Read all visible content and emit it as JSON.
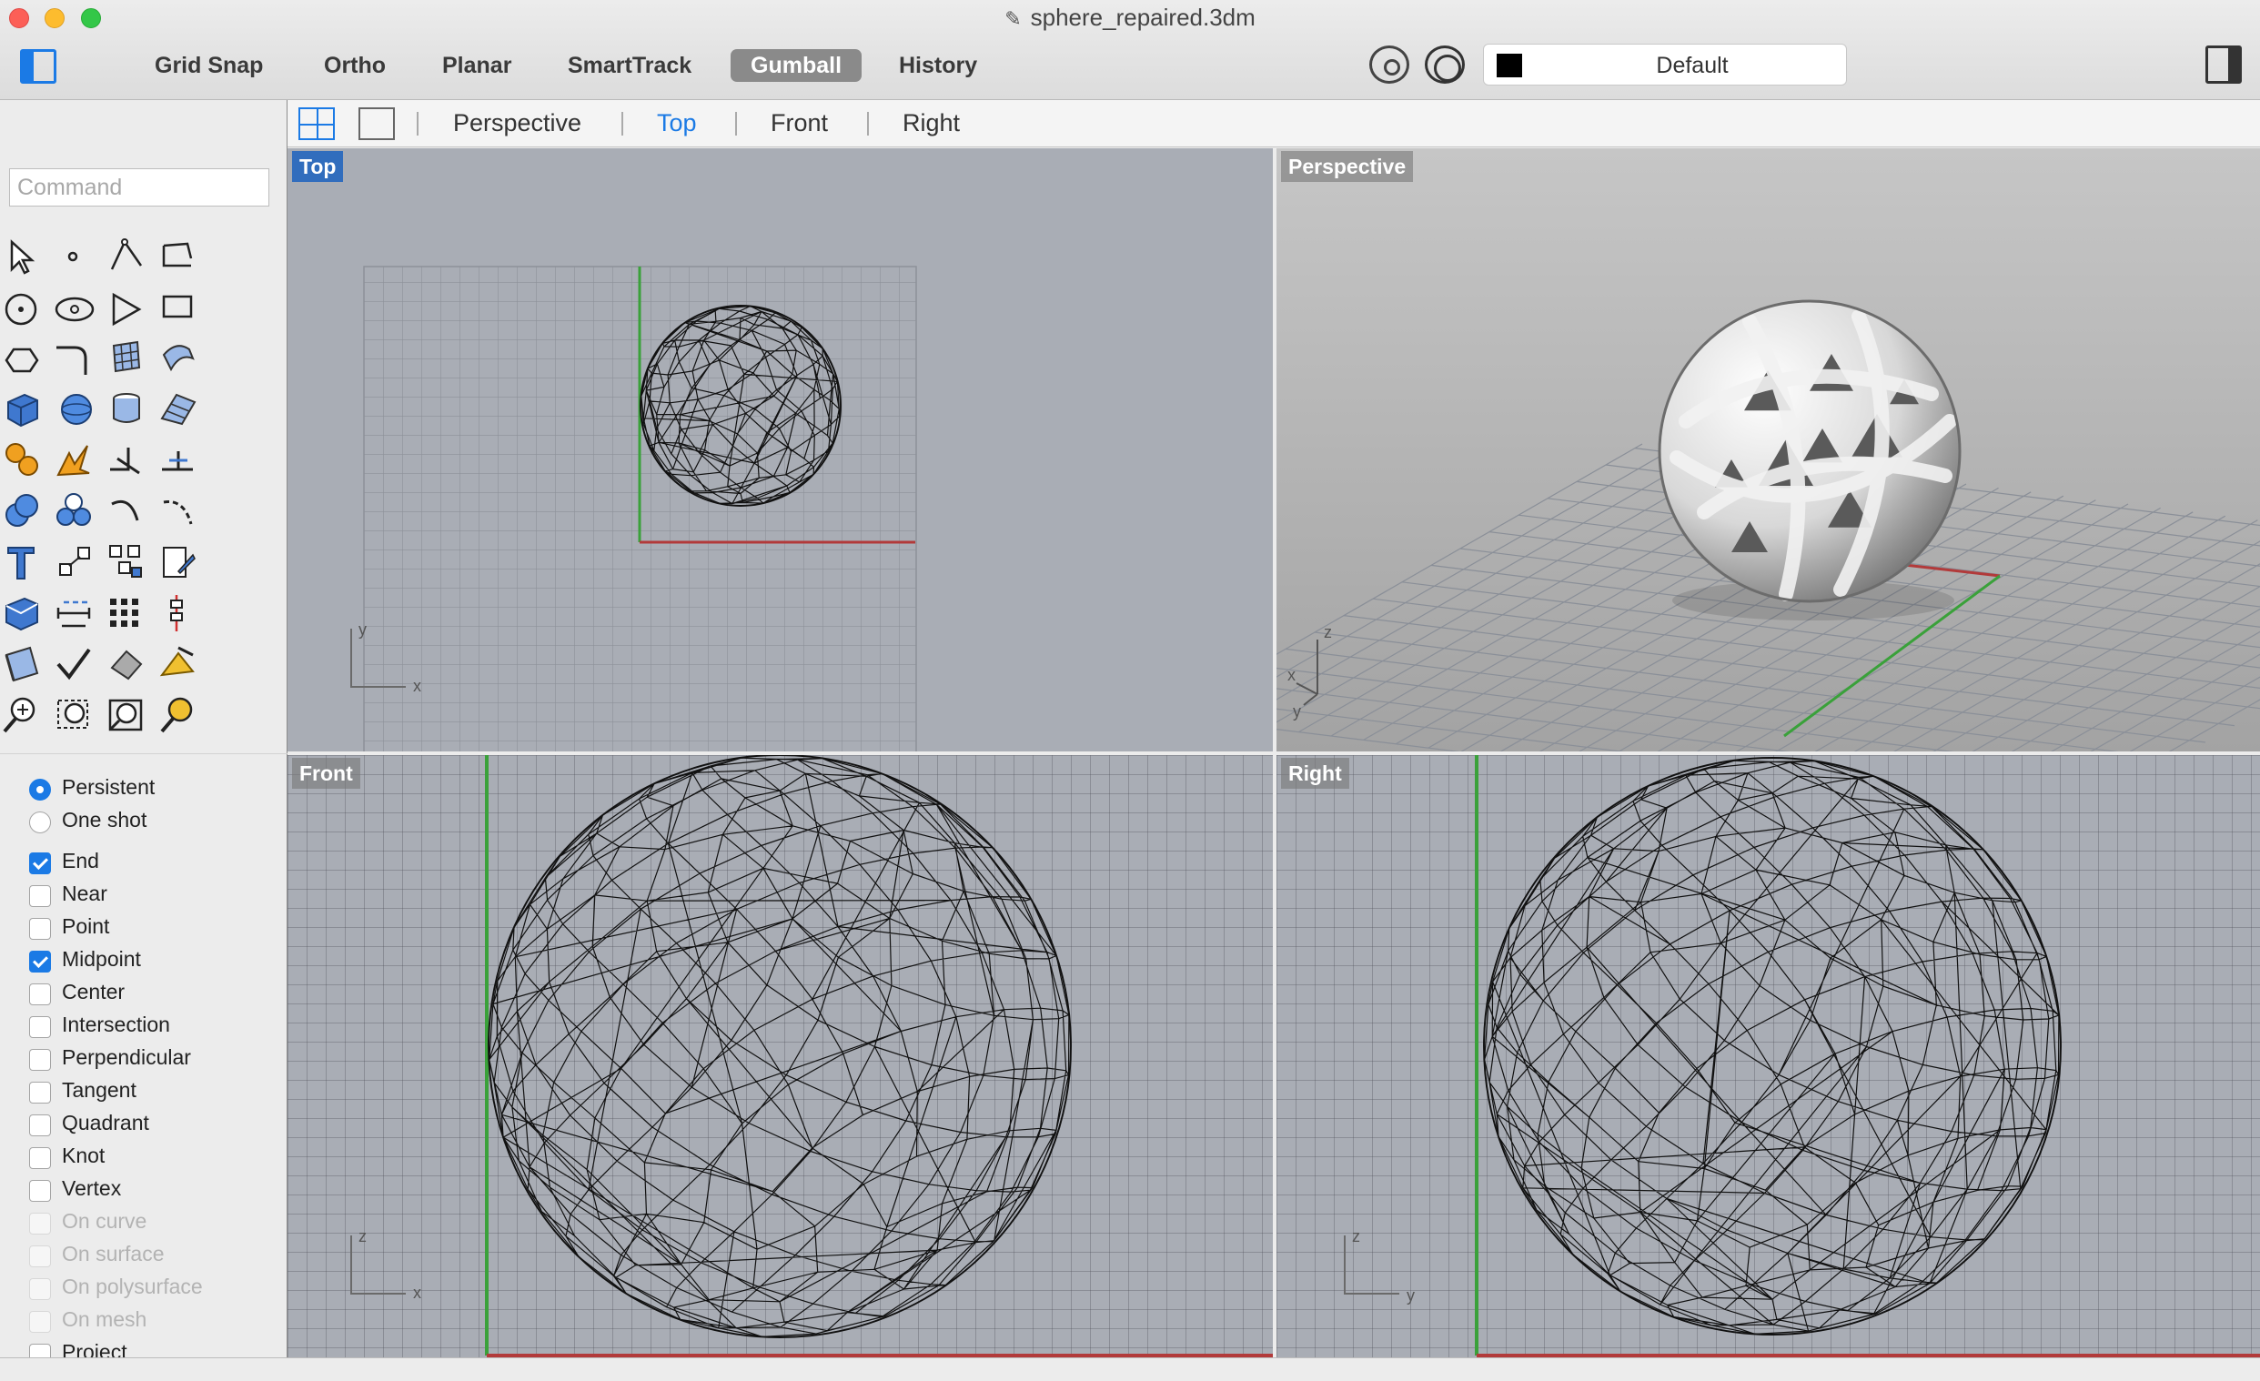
{
  "window": {
    "title": "sphere_repaired.3dm"
  },
  "toolbar": {
    "modes": [
      {
        "label": "Grid Snap",
        "active": false
      },
      {
        "label": "Ortho",
        "active": false
      },
      {
        "label": "Planar",
        "active": false
      },
      {
        "label": "SmartTrack",
        "active": false
      },
      {
        "label": "Gumball",
        "active": true
      },
      {
        "label": "History",
        "active": false
      }
    ],
    "layer": {
      "name": "Default",
      "swatch_color": "#000000"
    }
  },
  "view_tabs": {
    "tabs": [
      {
        "label": "Perspective",
        "active": false
      },
      {
        "label": "Top",
        "active": true
      },
      {
        "label": "Front",
        "active": false
      },
      {
        "label": "Right",
        "active": false
      }
    ]
  },
  "command": {
    "placeholder": "Command",
    "value": ""
  },
  "tools": [
    "select-arrow-icon",
    "point-icon",
    "polyline-icon",
    "curve-icon",
    "circle-icon",
    "ellipse-icon",
    "arc-icon",
    "rectangle-icon",
    "polygon-icon",
    "fillet-curve-icon",
    "surface-from-points-icon",
    "loft-icon",
    "box-icon",
    "sphere-icon",
    "cylinder-icon",
    "surface-edit-icon",
    "gear-tools-icon",
    "explode-icon",
    "split-icon",
    "trim-icon",
    "boolean-union-icon",
    "boolean-group-icon",
    "offset-curve-icon",
    "curve-edit-icon",
    "text-icon",
    "scale-icon",
    "array-icon",
    "layout-edit-icon",
    "solid-edit-icon",
    "dimension-icon",
    "grid-array-icon",
    "vertical-align-icon",
    "cut-plane-icon",
    "check-icon",
    "render-shape-icon",
    "material-icon",
    "zoom-icon",
    "zoom-window-icon",
    "zoom-extents-icon",
    "zoom-selected-icon"
  ],
  "osnap": {
    "mode": [
      {
        "label": "Persistent",
        "checked": true
      },
      {
        "label": "One shot",
        "checked": false
      }
    ],
    "snaps": [
      {
        "label": "End",
        "checked": true,
        "enabled": true
      },
      {
        "label": "Near",
        "checked": false,
        "enabled": true
      },
      {
        "label": "Point",
        "checked": false,
        "enabled": true
      },
      {
        "label": "Midpoint",
        "checked": true,
        "enabled": true
      },
      {
        "label": "Center",
        "checked": false,
        "enabled": true
      },
      {
        "label": "Intersection",
        "checked": false,
        "enabled": true
      },
      {
        "label": "Perpendicular",
        "checked": false,
        "enabled": true
      },
      {
        "label": "Tangent",
        "checked": false,
        "enabled": true
      },
      {
        "label": "Quadrant",
        "checked": false,
        "enabled": true
      },
      {
        "label": "Knot",
        "checked": false,
        "enabled": true
      },
      {
        "label": "Vertex",
        "checked": false,
        "enabled": true
      },
      {
        "label": "On curve",
        "checked": false,
        "enabled": false
      },
      {
        "label": "On surface",
        "checked": false,
        "enabled": false
      },
      {
        "label": "On polysurface",
        "checked": false,
        "enabled": false
      },
      {
        "label": "On mesh",
        "checked": false,
        "enabled": false
      },
      {
        "label": "Project",
        "checked": false,
        "enabled": true
      }
    ]
  },
  "viewports": [
    {
      "label": "Top",
      "active": true,
      "axis_h": "x",
      "axis_v": "y"
    },
    {
      "label": "Perspective",
      "active": false,
      "axis_a": "x",
      "axis_b": "y",
      "axis_v": "z"
    },
    {
      "label": "Front",
      "active": false,
      "axis_h": "x",
      "axis_v": "z"
    },
    {
      "label": "Right",
      "active": false,
      "axis_h": "y",
      "axis_v": "z"
    }
  ],
  "colors": {
    "accent": "#1b7ae5",
    "x_axis": "#b23a3a",
    "y_axis": "#3aa13a",
    "active_viewport_label": "#316dbd"
  }
}
